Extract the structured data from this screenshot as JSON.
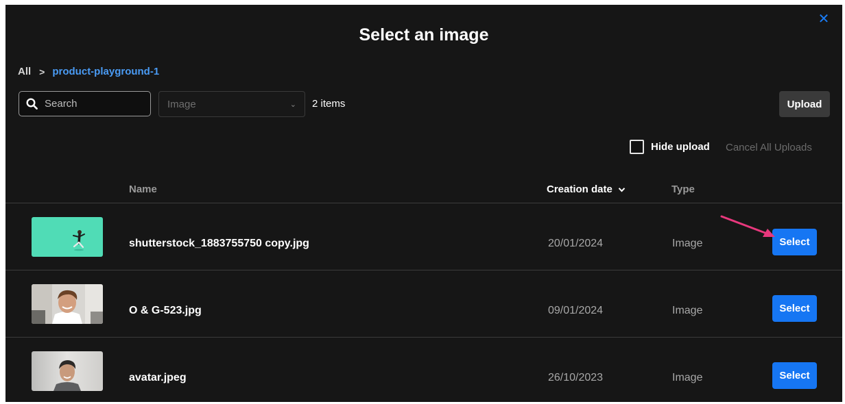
{
  "dialog": {
    "title": "Select an image",
    "close_icon": "close-icon"
  },
  "breadcrumb": {
    "root": "All",
    "separator": ">",
    "current": "product-playground-1"
  },
  "toolbar": {
    "search_placeholder": "Search",
    "type_filter_value": "Image",
    "items_count": "2 items",
    "upload_label": "Upload"
  },
  "upload_options": {
    "hide_upload_label": "Hide upload",
    "hide_upload_checked": false,
    "cancel_all_label": "Cancel All Uploads"
  },
  "table": {
    "columns": {
      "name": "Name",
      "creation_date": "Creation date",
      "type": "Type"
    },
    "sort": {
      "column": "creation_date",
      "direction": "descending"
    },
    "rows": [
      {
        "name": "shutterstock_1883755750 copy.jpg",
        "date": "20/01/2024",
        "type": "Image",
        "select_label": "Select",
        "thumbnail": "person-jumping-on-teal-background"
      },
      {
        "name": "O & G-523.jpg",
        "date": "09/01/2024",
        "type": "Image",
        "select_label": "Select",
        "thumbnail": "smiling-man-portrait"
      },
      {
        "name": "avatar.jpeg",
        "date": "26/10/2023",
        "type": "Image",
        "select_label": "Select",
        "thumbnail": "man-avatar-portrait"
      }
    ]
  },
  "colors": {
    "background": "#161616",
    "accent_blue": "#1676f3",
    "breadcrumb_link": "#4a9bf4",
    "annotation_arrow": "#e8387d"
  }
}
